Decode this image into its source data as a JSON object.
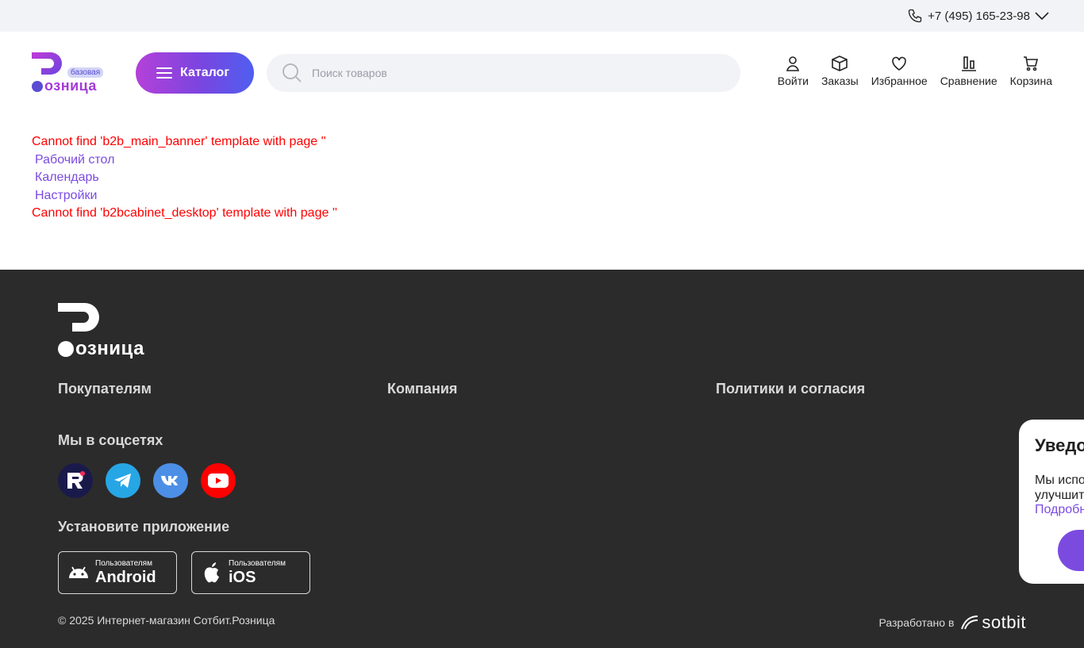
{
  "topbar": {
    "phone": "+7 (495) 165-23-98"
  },
  "header": {
    "logo_badge": "базовая",
    "logo_word": "озница",
    "catalog_label": "Каталог",
    "search_placeholder": "Поиск товаров",
    "nav": {
      "login": "Войти",
      "orders": "Заказы",
      "favorites": "Избранное",
      "compare": "Сравнение",
      "cart": "Корзина"
    }
  },
  "content": {
    "error1": "Cannot find 'b2b_main_banner' template with page ''",
    "links": [
      "Рабочий стол",
      "Календарь",
      "Настройки"
    ],
    "error2": "Cannot find 'b2bcabinet_desktop' template with page ''"
  },
  "footer": {
    "logo_word": "озница",
    "col_buyers": "Покупателям",
    "col_company": "Компания",
    "col_policies": "Политики и согласия",
    "social_title": "Мы в соцсетях",
    "app_title": "Установите приложение",
    "app_android_small": "Пользователям",
    "app_android_big": "Android",
    "app_ios_small": "Пользователям",
    "app_ios_big": "iOS",
    "copyright": "© 2025 Интернет-магазин Сотбит.Розница",
    "dev_label": "Разработано в",
    "dev_brand": "sotbit"
  },
  "notification": {
    "title": "Уведо",
    "text_line1": "Мы испо",
    "text_line2": "улучшит",
    "more": "Подробн"
  },
  "colors": {
    "accent": "#7b4be0",
    "error": "#ff0000",
    "footer_bg": "#2b2b2b",
    "logo_purple": "#a33ad9"
  }
}
